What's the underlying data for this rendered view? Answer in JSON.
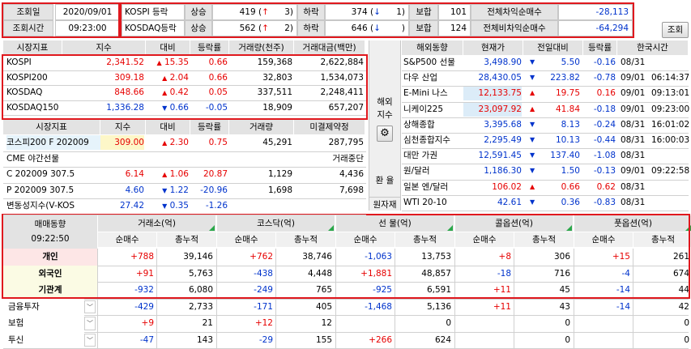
{
  "colors": {
    "up": "#e60000",
    "down": "#0033cc",
    "frame": "#e0181e",
    "header_bg": "#e3e3e3",
    "row_highlight": "#fde6e6",
    "row_yellow": "#fbfbe4"
  },
  "top": {
    "query_date_label": "조회일",
    "query_date": "2020/09/01",
    "query_time_label": "조회시간",
    "query_time": "09:23:00",
    "kospi_label": "KOSPI 등락",
    "kosdaq_label": "KOSDAQ등락",
    "up_label": "상승",
    "down_label": "하락",
    "flat_label": "보합",
    "kospi_up": "419",
    "kospi_up_limit": "3",
    "kospi_down": "374",
    "kospi_down_limit": "1",
    "kospi_flat": "101",
    "kosdaq_up": "562",
    "kosdaq_up_limit": "2",
    "kosdaq_down": "646",
    "kosdaq_down_limit": "",
    "kosdaq_flat": "124",
    "arb_label": "전체차익순매수",
    "arb_value": "-28,113",
    "nonarb_label": "전체비차익순매수",
    "nonarb_value": "-64,294",
    "query_button": "조회"
  },
  "market": {
    "headers": [
      "시장지표",
      "지수",
      "대비",
      "등락률",
      "거래량(천주)",
      "거래대금(백만)"
    ],
    "rows": [
      {
        "name": "KOSPI",
        "index": "2,341.52",
        "arrow": "▲",
        "change": "15.35",
        "rate": "0.66",
        "volume": "159,368",
        "amount": "2,622,884",
        "dir": "up"
      },
      {
        "name": "KOSPI200",
        "index": "309.18",
        "arrow": "▲",
        "change": "2.04",
        "rate": "0.66",
        "volume": "32,803",
        "amount": "1,534,073",
        "dir": "up"
      },
      {
        "name": "KOSDAQ",
        "index": "848.66",
        "arrow": "▲",
        "change": "0.42",
        "rate": "0.05",
        "volume": "337,511",
        "amount": "2,248,411",
        "dir": "up"
      },
      {
        "name": "KOSDAQ150",
        "index": "1,336.28",
        "arrow": "▼",
        "change": "0.66",
        "rate": "-0.05",
        "volume": "18,909",
        "amount": "657,207",
        "dir": "down"
      }
    ]
  },
  "derivs": {
    "headers": [
      "시장지표",
      "지수",
      "대비",
      "등락률",
      "거래량",
      "미결제약정"
    ],
    "rows": [
      {
        "name": "코스피200 F 202009",
        "index": "309.00",
        "arrow": "▲",
        "change": "2.30",
        "rate": "0.75",
        "volume": "45,291",
        "oi": "287,795",
        "dir": "up"
      },
      {
        "name": "CME 야간선물",
        "index": "",
        "arrow": "",
        "change": "",
        "rate": "",
        "volume": "",
        "oi": "거래중단",
        "dir": ""
      },
      {
        "name": "C 202009 307.5",
        "index": "6.14",
        "arrow": "▲",
        "change": "1.06",
        "rate": "20.87",
        "volume": "1,129",
        "oi": "4,436",
        "dir": "up"
      },
      {
        "name": "P 202009 307.5",
        "index": "4.60",
        "arrow": "▼",
        "change": "1.22",
        "rate": "-20.96",
        "volume": "1,698",
        "oi": "7,698",
        "dir": "down"
      },
      {
        "name": "변동성지수(V-KOS",
        "index": "27.42",
        "arrow": "▼",
        "change": "0.35",
        "rate": "-1.26",
        "volume": "",
        "oi": "",
        "dir": "down"
      }
    ]
  },
  "side_buttons": {
    "overseas_line1": "해외",
    "overseas_line2": "지수",
    "fx_label": "환 율",
    "commodity_label": "원자재"
  },
  "overseas": {
    "headers": [
      "해외동향",
      "현재가",
      "전일대비",
      "등락률",
      "한국시간"
    ],
    "rows": [
      {
        "name": "S&P500 선물",
        "price": "3,498.90",
        "arrow": "▼",
        "change": "5.50",
        "rate": "-0.16",
        "date": "08/31",
        "time": "",
        "dir": "down"
      },
      {
        "name": "다우 산업",
        "price": "28,430.05",
        "arrow": "▼",
        "change": "223.82",
        "rate": "-0.78",
        "date": "09/01",
        "time": "06:14:37",
        "dir": "down"
      },
      {
        "name": "E-Mini 나스",
        "price": "12,133.75",
        "arrow": "▲",
        "change": "19.75",
        "rate": "0.16",
        "date": "09/01",
        "time": "09:13:01",
        "dir": "up"
      },
      {
        "name": "니케이225",
        "price": "23,097.92",
        "arrow": "▲",
        "change": "41.84",
        "rate": "-0.18",
        "date": "09/01",
        "time": "09:23:00",
        "dir": "up"
      },
      {
        "name": "상해종합",
        "price": "3,395.68",
        "arrow": "▼",
        "change": "8.13",
        "rate": "-0.24",
        "date": "08/31",
        "time": "16:01:02",
        "dir": "down"
      },
      {
        "name": "심천종합지수",
        "price": "2,295.49",
        "arrow": "▼",
        "change": "10.13",
        "rate": "-0.44",
        "date": "08/31",
        "time": "16:00:03",
        "dir": "down"
      },
      {
        "name": "대만 가권",
        "price": "12,591.45",
        "arrow": "▼",
        "change": "137.40",
        "rate": "-1.08",
        "date": "08/31",
        "time": "",
        "dir": "down"
      },
      {
        "name": "원/달러",
        "price": "1,186.30",
        "arrow": "▼",
        "change": "1.50",
        "rate": "-0.13",
        "date": "09/01",
        "time": "09:22:58",
        "dir": "down"
      },
      {
        "name": "일본 엔/달러",
        "price": "106.02",
        "arrow": "▲",
        "change": "0.66",
        "rate": "0.62",
        "date": "08/31",
        "time": "",
        "dir": "up"
      },
      {
        "name": "WTI 20-10",
        "price": "42.61",
        "arrow": "▼",
        "change": "0.36",
        "rate": "-0.83",
        "date": "08/31",
        "time": "",
        "dir": "down"
      }
    ]
  },
  "flow": {
    "title": "매매동향",
    "time": "09:22:50",
    "groups": [
      "거래소(억)",
      "코스닥(억)",
      "선  물(억)",
      "콜옵션(억)",
      "풋옵션(억)"
    ],
    "subheaders": [
      "순매수",
      "총누적"
    ],
    "rows": [
      {
        "name": "개인",
        "vals": [
          "+788",
          "39,146",
          "+762",
          "38,746",
          "-1,063",
          "13,753",
          "+8",
          "306",
          "+15",
          "261"
        ]
      },
      {
        "name": "외국인",
        "vals": [
          "+91",
          "5,763",
          "-438",
          "4,448",
          "+1,881",
          "48,857",
          "-18",
          "716",
          "-4",
          "674"
        ]
      },
      {
        "name": "기관계",
        "vals": [
          "-932",
          "6,080",
          "-249",
          "765",
          "-925",
          "6,591",
          "+11",
          "45",
          "-14",
          "44"
        ]
      },
      {
        "name": "금융투자",
        "vals": [
          "-429",
          "2,733",
          "-171",
          "405",
          "-1,468",
          "5,136",
          "+11",
          "43",
          "-14",
          "42"
        ]
      },
      {
        "name": "보험",
        "vals": [
          "+9",
          "21",
          "+12",
          "12",
          "",
          "0",
          "",
          "0",
          "",
          "0"
        ]
      },
      {
        "name": "투신",
        "vals": [
          "-47",
          "143",
          "-29",
          "155",
          "+266",
          "624",
          "",
          "0",
          "",
          "0"
        ]
      }
    ]
  }
}
